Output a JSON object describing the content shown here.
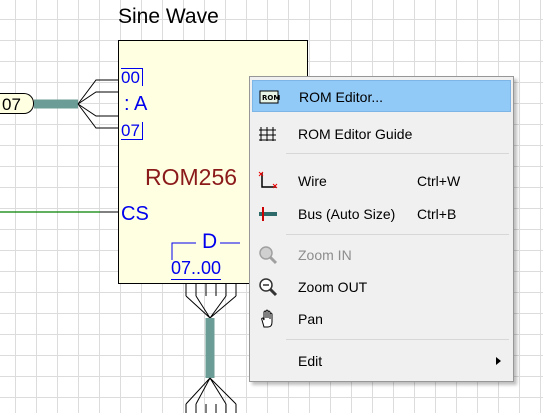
{
  "circuit": {
    "title": "Sine Wave",
    "bus_label": "07",
    "addr_top": "00",
    "addr_pin": ": A",
    "addr_bottom": "07",
    "rom_name": "ROM256",
    "cs_label": "CS",
    "data_label": "D",
    "data_range": "07..00"
  },
  "menu": {
    "items": [
      {
        "label": "ROM Editor...",
        "icon": "rom-chip-icon",
        "highlighted": true
      },
      {
        "label": "ROM Editor Guide",
        "icon": "grid-guide-icon"
      },
      {
        "label": "Wire",
        "shortcut": "Ctrl+W",
        "icon": "wire-icon"
      },
      {
        "label": "Bus (Auto Size)",
        "shortcut": "Ctrl+B",
        "icon": "bus-icon"
      },
      {
        "label": "Zoom IN",
        "icon": "zoom-in-icon",
        "disabled": true
      },
      {
        "label": "Zoom OUT",
        "icon": "zoom-out-icon"
      },
      {
        "label": "Pan",
        "icon": "hand-pan-icon"
      },
      {
        "label": "Edit",
        "icon": "submenu-arrow-icon"
      }
    ]
  },
  "colors": {
    "bus": "#6b9c96",
    "rom_fill": "#ffffe1",
    "pin_blue": "#0000ee",
    "rom_name": "#8b1a1a",
    "highlight": "#91c9f7",
    "wire_green": "#008000"
  }
}
